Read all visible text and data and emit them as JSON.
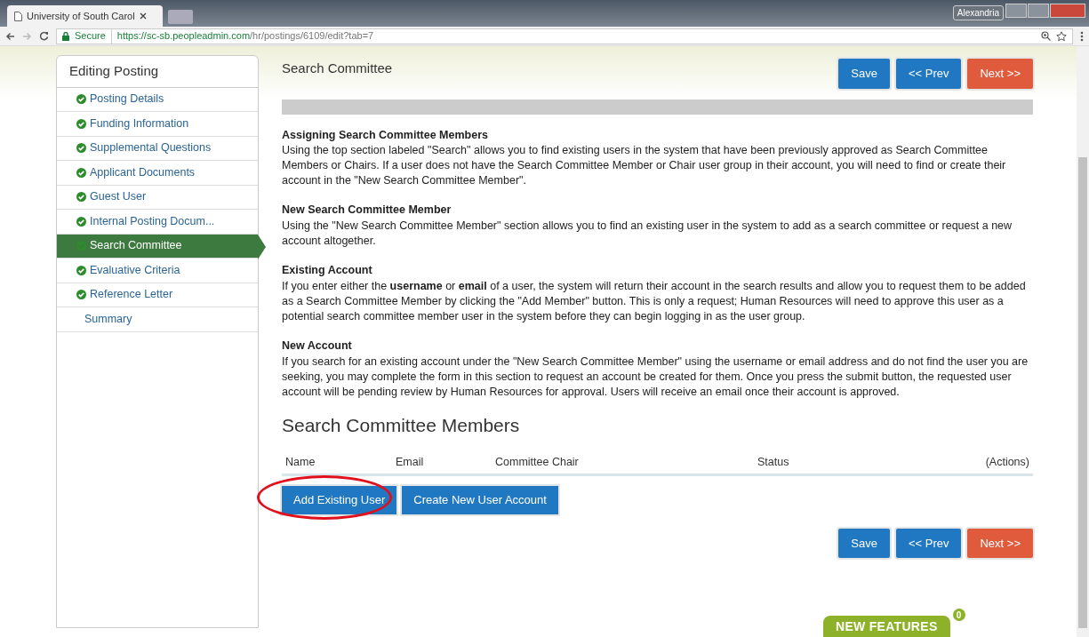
{
  "browser": {
    "tab_title": "University of South Carol",
    "profile": "Alexandria",
    "secure_label": "Secure",
    "url_host": "https://sc-sb.peopleadmin.com",
    "url_path": "/hr/postings/6109/edit?tab=7"
  },
  "sidebar": {
    "title": "Editing Posting",
    "items": [
      {
        "label": "Posting Details",
        "done": true,
        "selected": false
      },
      {
        "label": "Funding Information",
        "done": true,
        "selected": false
      },
      {
        "label": "Supplemental Questions",
        "done": true,
        "selected": false
      },
      {
        "label": "Applicant Documents",
        "done": true,
        "selected": false
      },
      {
        "label": "Guest User",
        "done": true,
        "selected": false
      },
      {
        "label": "Internal Posting Docum...",
        "done": true,
        "selected": false
      },
      {
        "label": "Search Committee",
        "done": true,
        "selected": true
      },
      {
        "label": "Evaluative Criteria",
        "done": true,
        "selected": false
      },
      {
        "label": "Reference Letter",
        "done": true,
        "selected": false
      },
      {
        "label": "Summary",
        "done": false,
        "selected": false
      }
    ]
  },
  "page_title": "Search Committee",
  "nav_buttons": [
    {
      "label": "Save",
      "kind": "primary"
    },
    {
      "label": "<< Prev",
      "kind": "primary"
    },
    {
      "label": "Next >>",
      "kind": "danger"
    }
  ],
  "sections": [
    {
      "heading": "Assigning Search Committee Members",
      "text": "Using the top section labeled \"Search\" allows you to find existing users in the system that have been previously approved as Search Committee Members or Chairs. If a user does not have the Search Committee Member or Chair user group in their account, you will need to find or create their account in the \"New Search Committee Member\"."
    },
    {
      "heading": "New Search Committee Member",
      "text": "Using the \"New Search Committee Member\" section allows you to find an existing user in the system to add as a search committee or request a new account altogether."
    },
    {
      "heading": "Existing Account",
      "text": "If you enter either the **username** or **email** of a user, the system will return their account in the search results and allow you to request them to be added as a Search Committee Member by clicking the \"Add Member\" button. This is only a request; Human Resources will need to approve this user as a potential search committee member user in the system before they can begin logging in as the user group."
    },
    {
      "heading": "New Account",
      "text": "If you search for an existing account under the \"New Search Committee Member\" using the username or email address and do not find the user you are seeking, you may complete the form in this section to request an account be created for them. Once you press the submit button, the requested user account will be pending review by Human Resources for approval. Users will receive an email once their account is approved."
    }
  ],
  "members": {
    "heading": "Search Committee Members",
    "columns": [
      "Name",
      "Email",
      "Committee Chair",
      "Status",
      "(Actions)"
    ]
  },
  "member_buttons": [
    {
      "label": "Add Existing User",
      "circled": true
    },
    {
      "label": "Create New User Account",
      "circled": false
    }
  ],
  "bottom_buttons": [
    {
      "label": "Save",
      "kind": "primary"
    },
    {
      "label": "<< Prev",
      "kind": "primary"
    },
    {
      "label": "Next >>",
      "kind": "danger"
    }
  ],
  "new_features": {
    "label": "NEW FEATURES",
    "count": "0"
  }
}
